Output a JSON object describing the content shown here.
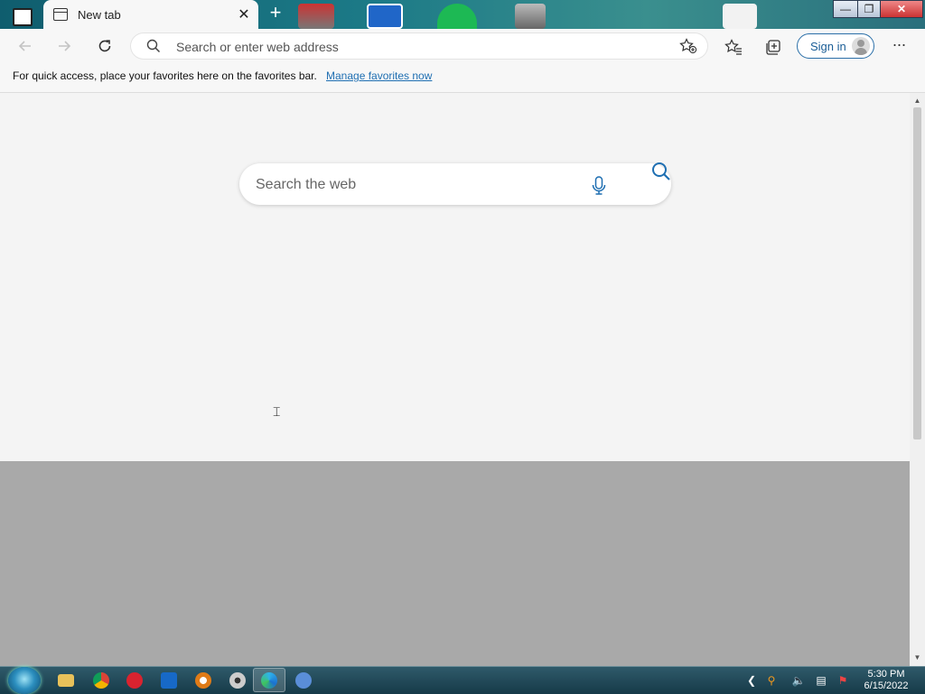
{
  "tab": {
    "label": "New tab"
  },
  "toolbar": {
    "address_placeholder": "Search or enter web address",
    "signin_label": "Sign in",
    "more_label": "···"
  },
  "favorites_bar": {
    "message": "For quick access, place your favorites here on the favorites bar.",
    "link": "Manage favorites now"
  },
  "page": {
    "search_placeholder": "Search the web"
  },
  "taskbar": {
    "time": "5:30 PM",
    "date": "6/15/2022"
  },
  "colors": {
    "accent": "#1f6fb2",
    "page_bg": "#f4f4f4",
    "lower_page_bg": "#a9a9a9"
  }
}
